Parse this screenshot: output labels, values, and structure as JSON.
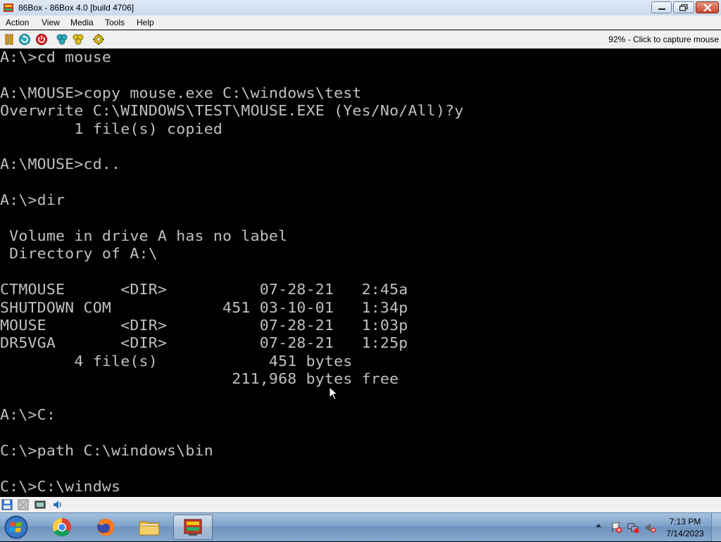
{
  "window": {
    "title": "86Box - 86Box 4.0 [build 4706]"
  },
  "menu": [
    "Action",
    "View",
    "Media",
    "Tools",
    "Help"
  ],
  "toolbar": {
    "status_message": "92% - Click to capture mouse",
    "icons": [
      "pause-icon",
      "reset-icon",
      "power-icon",
      "ctrl-alt-del-icon",
      "ctrl-alt-esc-icon",
      "settings-icon"
    ]
  },
  "console": {
    "lines": [
      "A:\\>cd mouse",
      "",
      "A:\\MOUSE>copy mouse.exe C:\\windows\\test",
      "Overwrite C:\\WINDOWS\\TEST\\MOUSE.EXE (Yes/No/All)?y",
      "        1 file(s) copied",
      "",
      "A:\\MOUSE>cd..",
      "",
      "A:\\>dir",
      "",
      " Volume in drive A has no label",
      " Directory of A:\\",
      "",
      "CTMOUSE      <DIR>          07-28-21   2:45a",
      "SHUTDOWN COM            451 03-10-01   1:34p",
      "MOUSE        <DIR>          07-28-21   1:03p",
      "DR5VGA       <DIR>          07-28-21   1:25p",
      "        4 file(s)            451 bytes",
      "                         211,968 bytes free",
      "",
      "A:\\>C:",
      "",
      "C:\\>path C:\\windows\\bin",
      "",
      "C:\\>C:\\windws"
    ]
  },
  "statusbar": {
    "icons": [
      "floppy-drive-icon",
      "floppy-drive-2-icon",
      "network-icon",
      "sound-icon"
    ]
  },
  "taskbar": {
    "apps": [
      "start-orb",
      "chrome",
      "firefox",
      "file-explorer",
      "86box"
    ],
    "clock_time": "7:13 PM",
    "clock_date": "7/14/2023"
  },
  "colors": {
    "console_bg": "#000000",
    "console_text": "#c0c0c0",
    "chrome_bg": "#f0f0f0"
  }
}
